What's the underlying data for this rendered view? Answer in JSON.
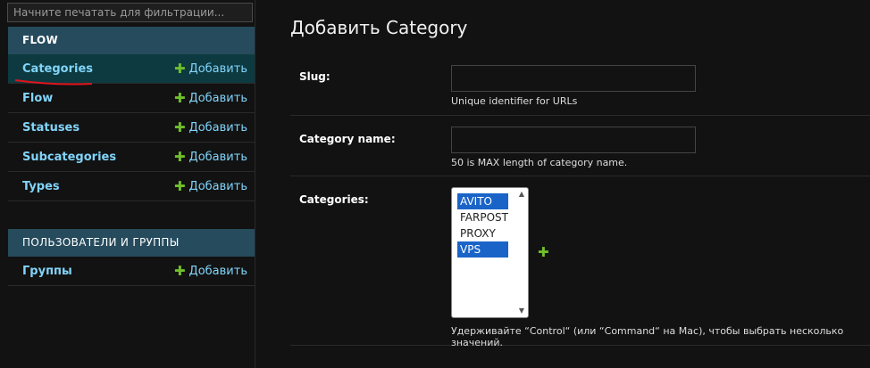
{
  "sidebar": {
    "filter_placeholder": "Начните печатать для фильтрации...",
    "modules": [
      {
        "caption": "FLOW",
        "items": [
          {
            "label": "Categories",
            "add": "Добавить"
          },
          {
            "label": "Flow",
            "add": "Добавить"
          },
          {
            "label": "Statuses",
            "add": "Добавить"
          },
          {
            "label": "Subcategories",
            "add": "Добавить"
          },
          {
            "label": "Types",
            "add": "Добавить"
          }
        ]
      },
      {
        "caption": "ПОЛЬЗОВАТЕЛИ И ГРУППЫ",
        "items": [
          {
            "label": "Группы",
            "add": "Добавить"
          }
        ]
      }
    ]
  },
  "main": {
    "title": "Добавить Category",
    "fields": {
      "slug": {
        "label": "Slug:",
        "value": "",
        "help": "Unique identifier for URLs"
      },
      "name": {
        "label": "Category name:",
        "value": "",
        "help": "50 is MAX length of category name."
      },
      "categories": {
        "label": "Categories:",
        "options": [
          "AVITO",
          "FARPOST",
          "PROXY",
          "VPS"
        ],
        "selected": [
          "AVITO",
          "VPS"
        ],
        "help": "Удерживайте “Control“ (или “Command“ на Mac), чтобы выбрать несколько значений."
      }
    }
  },
  "colors": {
    "module_header": "#264b5d",
    "link": "#81d4fa",
    "add_plus": "#70bf2b",
    "selected_option": "#1a64c8",
    "annotation_underline": "#e0141e"
  },
  "icons": {
    "add": "plus-icon"
  }
}
